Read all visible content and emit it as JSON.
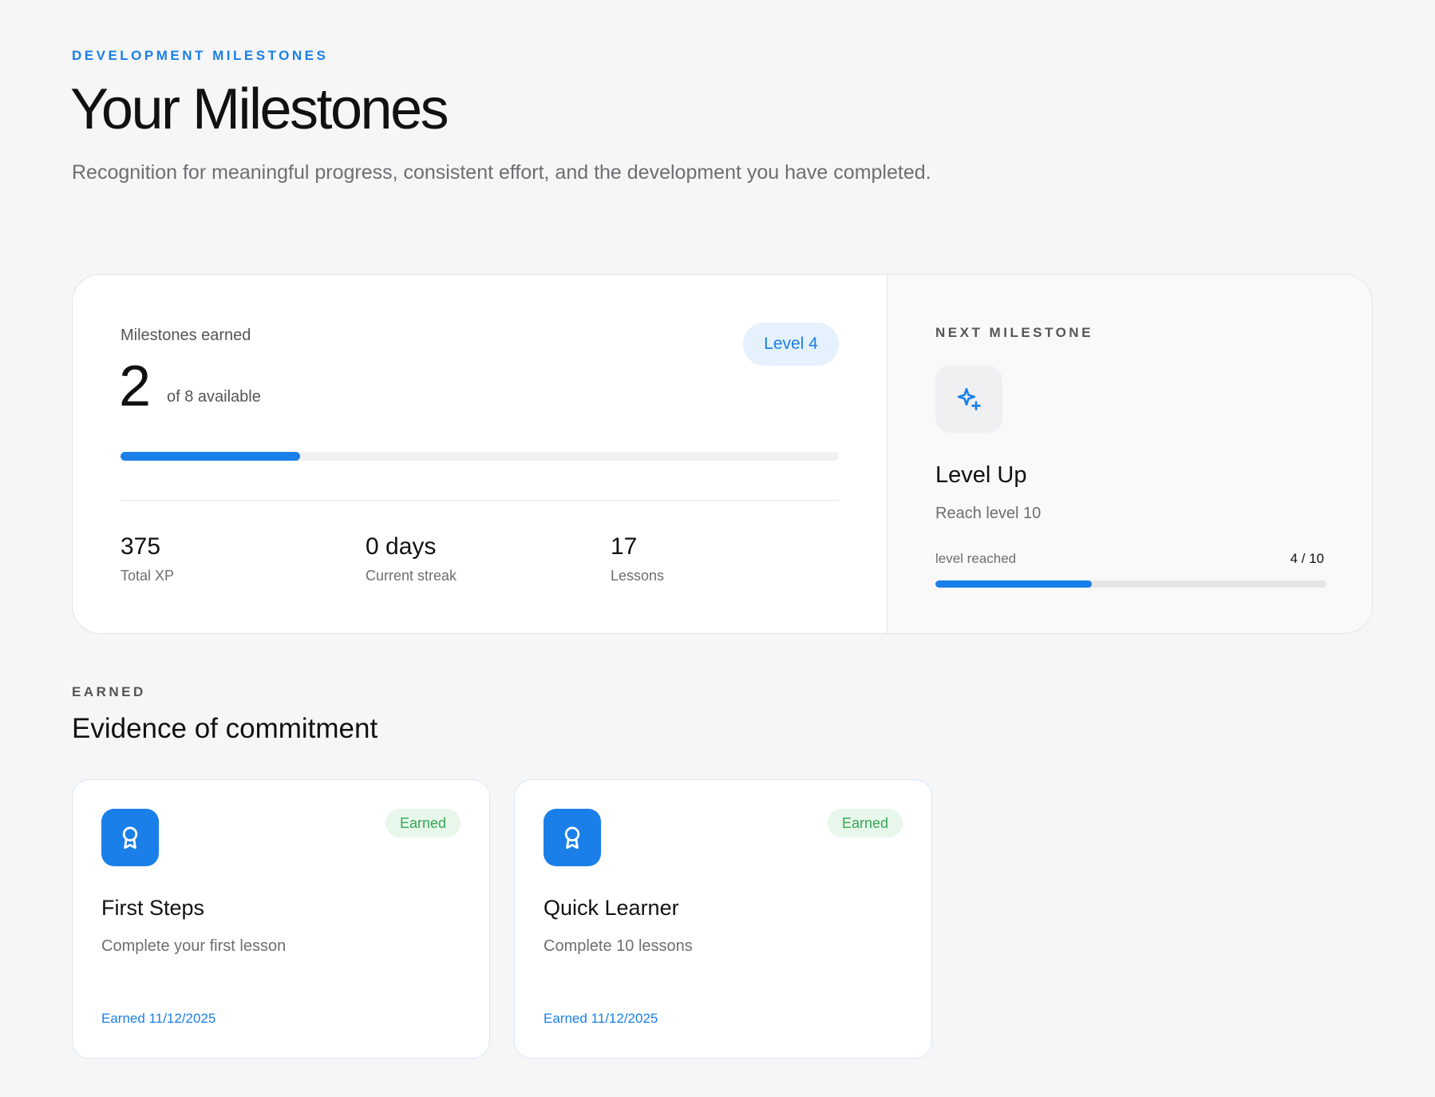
{
  "header": {
    "eyebrow": "DEVELOPMENT MILESTONES",
    "title": "Your Milestones",
    "subtitle": "Recognition for meaningful progress, consistent effort, and the development you have completed."
  },
  "summary": {
    "earned_label": "Milestones earned",
    "earned_count": "2",
    "earned_total_text": "of 8 available",
    "earned_fraction": 0.25,
    "level_badge": "Level 4",
    "stats": [
      {
        "value": "375",
        "label": "Total XP"
      },
      {
        "value": "0 days",
        "label": "Current streak"
      },
      {
        "value": "17",
        "label": "Lessons"
      }
    ]
  },
  "next_milestone": {
    "eyebrow": "NEXT MILESTONE",
    "icon": "sparkles-icon",
    "title": "Level Up",
    "description": "Reach level 10",
    "progress_label": "level reached",
    "progress_value": "4 / 10",
    "progress_fraction": 0.4
  },
  "earned_section": {
    "eyebrow": "EARNED",
    "title": "Evidence of commitment",
    "cards": [
      {
        "icon": "award-ribbon-icon",
        "status": "Earned",
        "title": "First Steps",
        "description": "Complete your first lesson",
        "date": "Earned 11/12/2025"
      },
      {
        "icon": "award-ribbon-icon",
        "status": "Earned",
        "title": "Quick Learner",
        "description": "Complete 10 lessons",
        "date": "Earned 11/12/2025"
      }
    ]
  },
  "colors": {
    "accent": "#1a7fe8",
    "earned_green": "#34a853",
    "earned_green_bg": "#e8f7ec",
    "page_bg": "#f6f6f6"
  }
}
